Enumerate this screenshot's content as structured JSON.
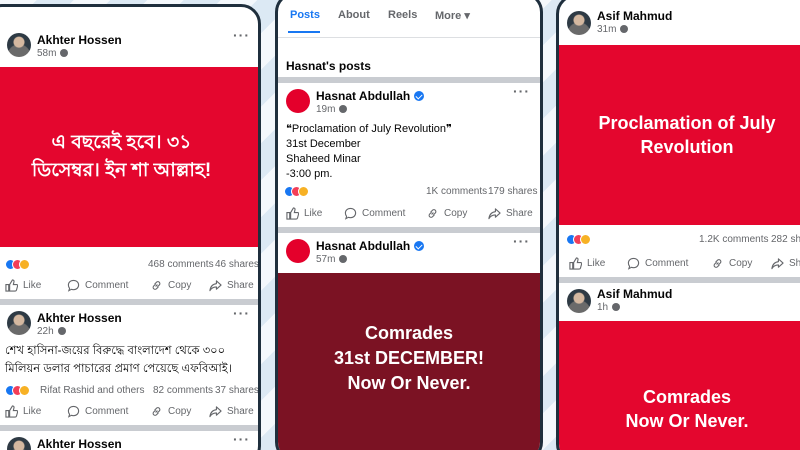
{
  "phone1": {
    "post1": {
      "author": "Akhter Hossen",
      "time": "58m",
      "headline": "এ বছরেই হবে। ৩১ ডিসেম্বর। ইন শা আল্লাহ!",
      "comments": "468 comments",
      "shares": "46 shares"
    },
    "post2": {
      "author": "Akhter Hossen",
      "time": "22h",
      "body": "শেখ হাসিনা-জয়ের বিরুদ্ধে বাংলাদেশ থেকে ৩০০ মিলিয়ন ডলার পাচারের প্রমাণ পেয়েছে এফবিআই।",
      "reactors": "Rifat Rashid and others",
      "comments": "82 comments",
      "shares": "37 shares"
    },
    "post3": {
      "author": "Akhter Hossen"
    }
  },
  "phone2": {
    "tabs": [
      "Posts",
      "About",
      "Reels",
      "More"
    ],
    "section_title": "Hasnat's posts",
    "post1": {
      "author": "Hasnat Abdullah",
      "time": "19m",
      "line1": "❝Proclamation of July Revolution❞",
      "line2": "31st December",
      "line3": "Shaheed Minar",
      "line4": "-3:00 pm.",
      "comments": "1K comments",
      "shares": "179 shares"
    },
    "post2": {
      "author": "Hasnat Abdullah",
      "time": "57m",
      "headline_l1": "Comrades",
      "headline_l2": "31st DECEMBER!",
      "headline_l3": "Now Or Never."
    }
  },
  "phone3": {
    "post1": {
      "author": "Asif Mahmud",
      "time": "31m",
      "headline": "Proclamation of July Revolution",
      "comments": "1.2K comments",
      "shares": "282 sha"
    },
    "post2": {
      "author": "Asif Mahmud",
      "time": "1h",
      "headline_l1": "Comrades",
      "headline_l2": "Now Or Never."
    }
  },
  "actions": {
    "like": "Like",
    "comment": "Comment",
    "copy": "Copy",
    "share": "Share"
  },
  "colors": {
    "fb_blue": "#1877f2",
    "post_red": "#e4062e",
    "post_maroon": "#7b1223",
    "frame": "#1f2f3d"
  },
  "icons": [
    "globe-icon",
    "verified-icon",
    "more-dots-icon",
    "like-icon",
    "comment-icon",
    "copy-icon",
    "share-icon",
    "chevron-down-icon"
  ]
}
